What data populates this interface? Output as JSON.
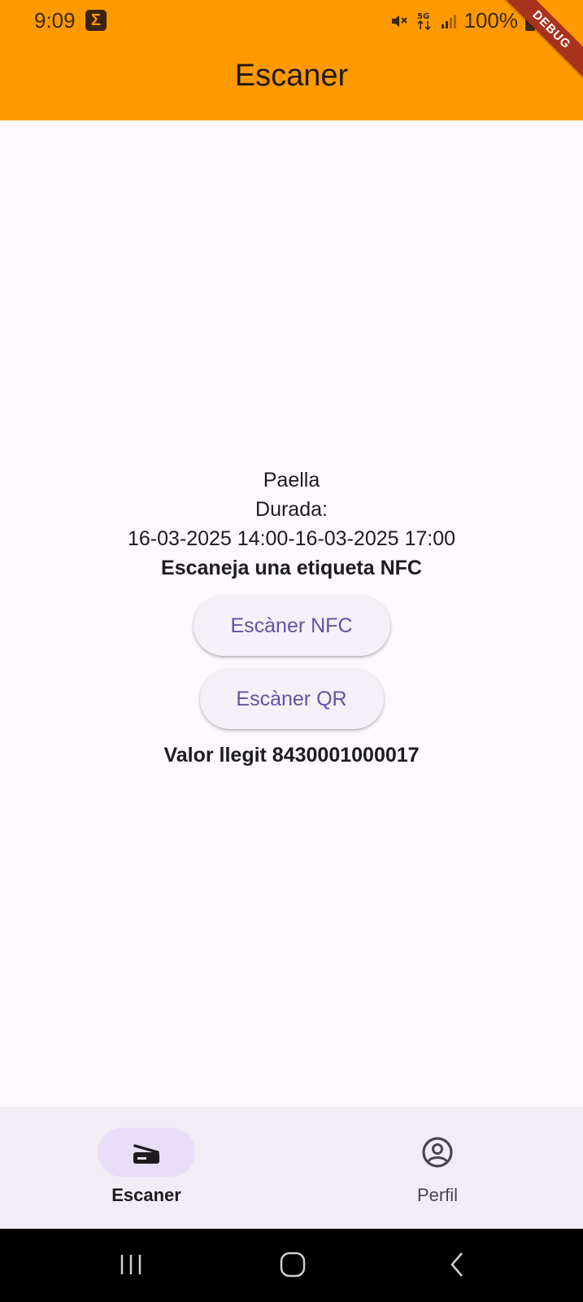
{
  "status_bar": {
    "time": "9:09",
    "battery": "100%",
    "network": "5G",
    "icons": [
      "sigma-icon",
      "mute-icon",
      "5g-icon",
      "signal-icon",
      "battery-icon"
    ]
  },
  "app_bar": {
    "title": "Escaner"
  },
  "debug_banner": "DEBUG",
  "event": {
    "name": "Paella",
    "duration_label": "Durada:",
    "duration_range": "16-03-2025 14:00-16-03-2025 17:00"
  },
  "instruction": "Escaneja una etiqueta NFC",
  "buttons": {
    "nfc": "Escàner NFC",
    "qr": "Escàner QR"
  },
  "read_value": "Valor llegit 8430001000017",
  "bottom_nav": {
    "items": [
      {
        "label": "Escaner",
        "icon": "scanner-icon",
        "selected": true
      },
      {
        "label": "Perfil",
        "icon": "account-circle-icon",
        "selected": false
      }
    ]
  },
  "colors": {
    "app_bar": "#ff9900",
    "primary": "#6750a4",
    "nav_indicator": "#e8def8",
    "background": "#fcf8fd"
  }
}
